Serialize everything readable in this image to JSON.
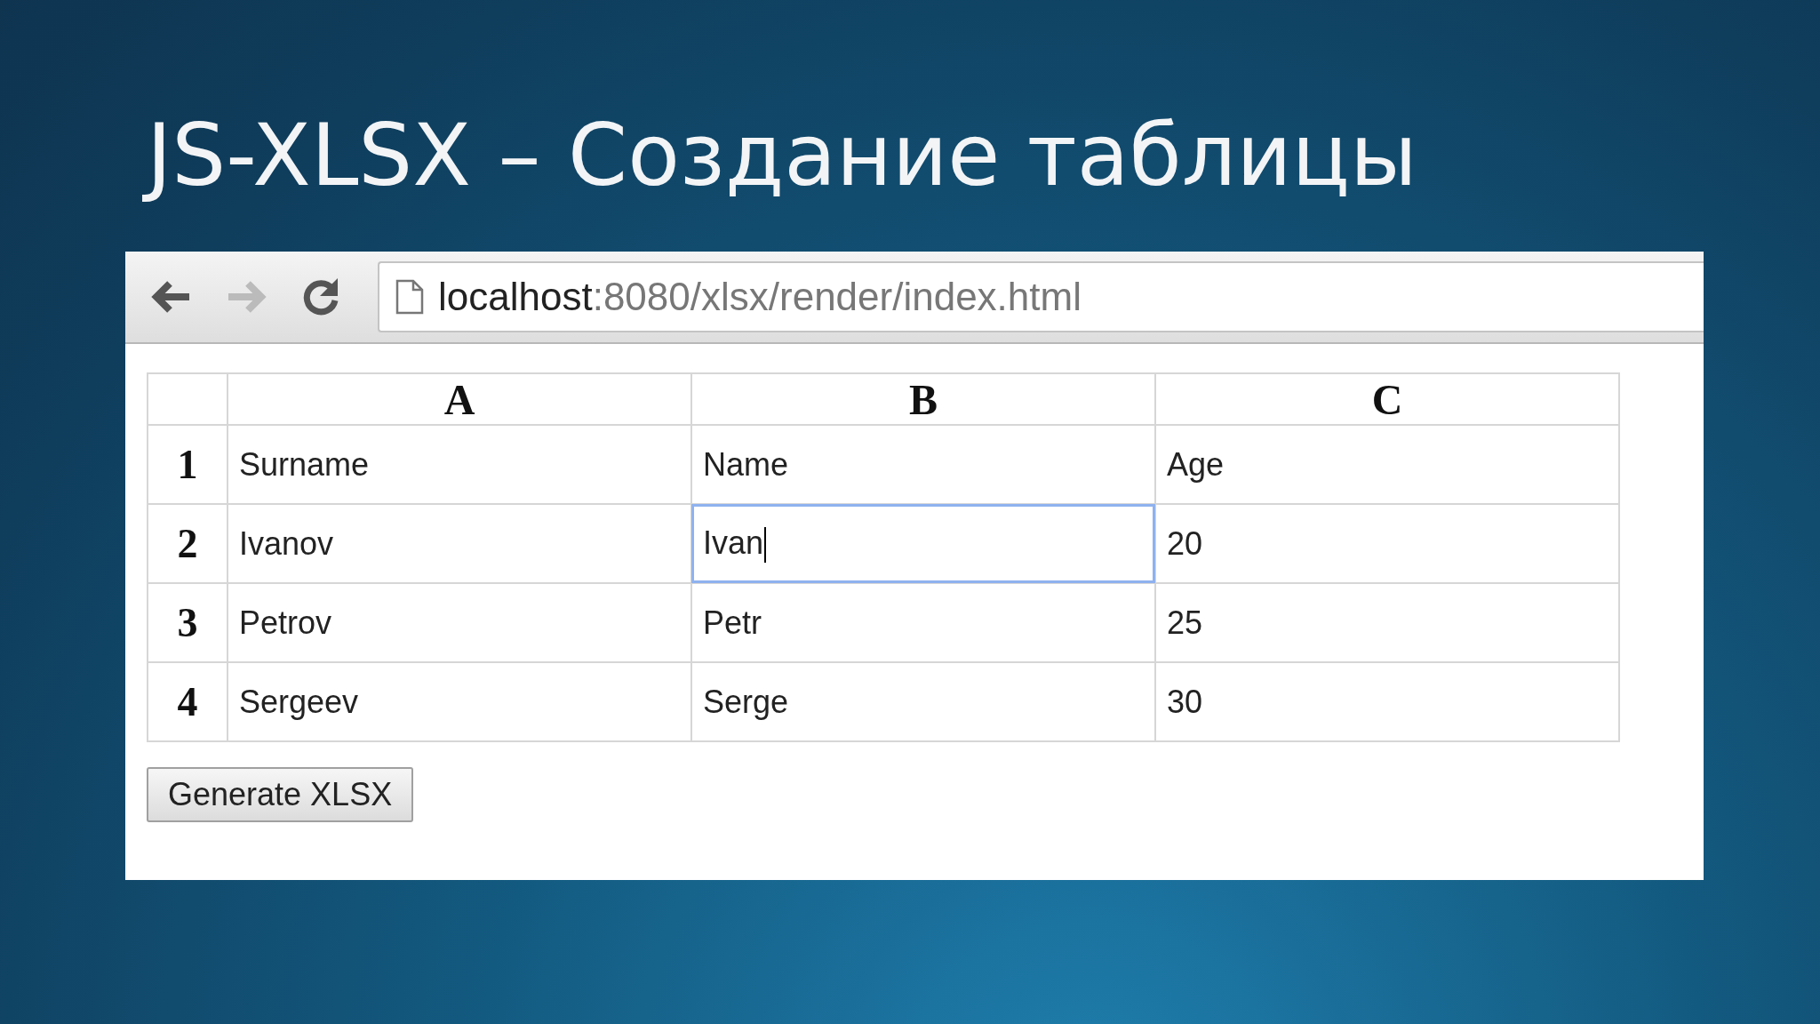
{
  "slide": {
    "title": "JS-XLSX – Создание таблицы"
  },
  "browser": {
    "url_host": "localhost",
    "url_path": ":8080/xlsx/render/index.html"
  },
  "table": {
    "columns": [
      "A",
      "B",
      "C"
    ],
    "rows": [
      {
        "number": "1",
        "cells": [
          {
            "text": "Surname",
            "focused": false
          },
          {
            "text": "Name",
            "focused": false
          },
          {
            "text": "Age",
            "focused": false
          }
        ]
      },
      {
        "number": "2",
        "cells": [
          {
            "text": "Ivanov",
            "focused": false
          },
          {
            "text": "Ivan",
            "focused": true
          },
          {
            "text": "20",
            "focused": false
          }
        ]
      },
      {
        "number": "3",
        "cells": [
          {
            "text": "Petrov",
            "focused": false
          },
          {
            "text": "Petr",
            "focused": false
          },
          {
            "text": "25",
            "focused": false
          }
        ]
      },
      {
        "number": "4",
        "cells": [
          {
            "text": "Sergeev",
            "focused": false
          },
          {
            "text": "Serge",
            "focused": false
          },
          {
            "text": "30",
            "focused": false
          }
        ]
      }
    ]
  },
  "button": {
    "label": "Generate XLSX"
  }
}
